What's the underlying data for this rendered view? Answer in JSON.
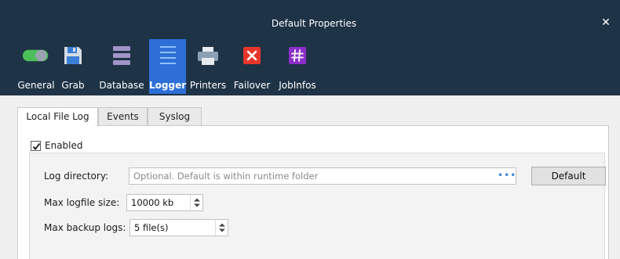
{
  "window": {
    "title": "Default Properties",
    "close_glyph": "✕"
  },
  "toolbar": {
    "items": [
      {
        "label": "General",
        "icon": "toggle-switch-icon"
      },
      {
        "label": "Grab",
        "icon": "floppy-disk-icon"
      },
      {
        "label": "Database",
        "icon": "database-icon"
      },
      {
        "label": "Logger",
        "icon": "list-icon",
        "active": true
      },
      {
        "label": "Printers",
        "icon": "printer-icon"
      },
      {
        "label": "Failover",
        "icon": "x-box-icon"
      },
      {
        "label": "JobInfos",
        "icon": "hash-icon"
      }
    ],
    "colors": {
      "header_bg": "#1f3346",
      "active_bg": "#2d6fd6",
      "failover_red": "#e8352b",
      "jobinfos_purple": "#8b2fc9"
    }
  },
  "tabs": [
    {
      "label": "Local File Log",
      "active": true
    },
    {
      "label": "Events"
    },
    {
      "label": "Syslog"
    }
  ],
  "form": {
    "enabled_label": "Enabled",
    "enabled": true,
    "log_directory": {
      "label": "Log directory:",
      "value": "",
      "placeholder": "Optional. Default is within runtime folder",
      "browse_glyph": "•••"
    },
    "default_button": "Default",
    "max_logfile_size": {
      "label": "Max logfile size:",
      "value": "10000 kb"
    },
    "max_backup_logs": {
      "label": "Max backup logs:",
      "value": "5 file(s)"
    }
  }
}
